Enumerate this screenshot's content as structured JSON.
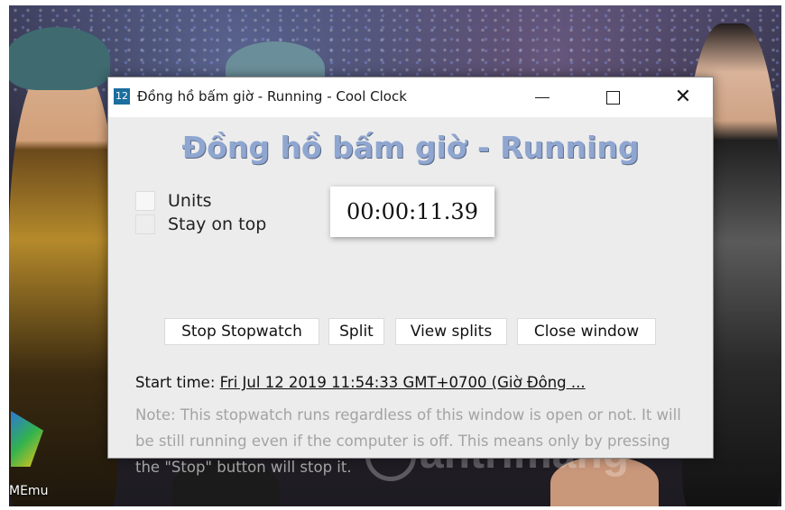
{
  "window": {
    "app_icon_text": "12",
    "title": "Đồng hồ bấm giờ - Running - Cool Clock",
    "close_symbol": "✕"
  },
  "main": {
    "heading": "Đồng hồ bấm giờ - Running",
    "options": [
      {
        "label": "Units",
        "checked": false
      },
      {
        "label": "Stay on top",
        "checked": false
      }
    ],
    "time": "00:00:11.39",
    "buttons": {
      "stop": "Stop Stopwatch",
      "split": "Split",
      "view_splits": "View splits",
      "close_window": "Close window"
    },
    "start_label": "Start time:",
    "start_value": "Fri Jul 12 2019 11:54:33 GMT+0700 (Giờ Đông ...",
    "note": "Note: This stopwatch runs regardless of this window is open or not. It will be still running even if the computer is off. This means only by pressing the \"Stop\" button will stop it."
  },
  "desktop": {
    "icon_label": "MEmu",
    "watermark": "antrimang"
  },
  "colors": {
    "heading": "#8fa6d0",
    "client_bg": "#ececec",
    "note_text": "#a3a3a3"
  }
}
